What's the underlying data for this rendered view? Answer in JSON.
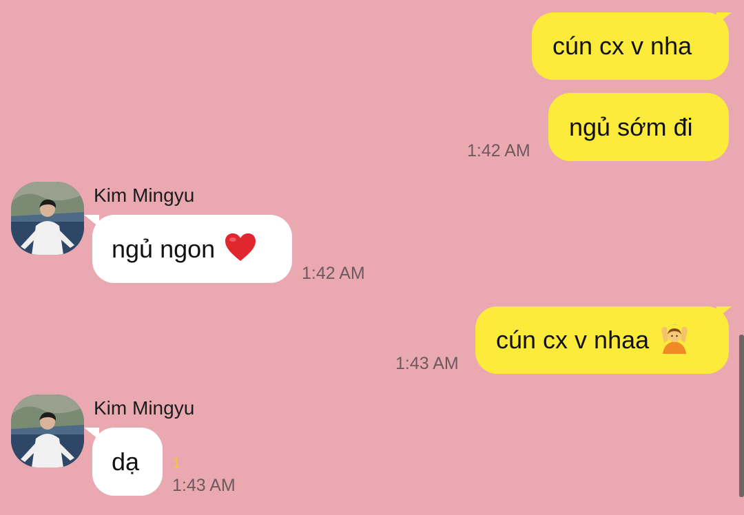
{
  "contact": {
    "name": "Kim Mingyu"
  },
  "messages": [
    {
      "id": "m1",
      "direction": "out",
      "text": "cún cx v nha",
      "time": ""
    },
    {
      "id": "m2",
      "direction": "out",
      "text": "ngủ sớm đi",
      "time": "1:42 AM"
    },
    {
      "id": "m3",
      "direction": "in",
      "sender": "Kim Mingyu",
      "text": "ngủ ngon",
      "emoji": "red-heart",
      "time": "1:42 AM"
    },
    {
      "id": "m4",
      "direction": "out",
      "text": "cún cx v nhaa",
      "emoji": "person-gesturing-ok",
      "time": "1:43 AM"
    },
    {
      "id": "m5",
      "direction": "in",
      "sender": "Kim Mingyu",
      "text": "dạ",
      "unread": "1",
      "time": "1:43 AM"
    }
  ],
  "colors": {
    "background": "#EAA8B1",
    "outgoing_bubble": "#FDEB3B",
    "incoming_bubble": "#FFFFFF",
    "unread_count": "#F5C53A"
  }
}
